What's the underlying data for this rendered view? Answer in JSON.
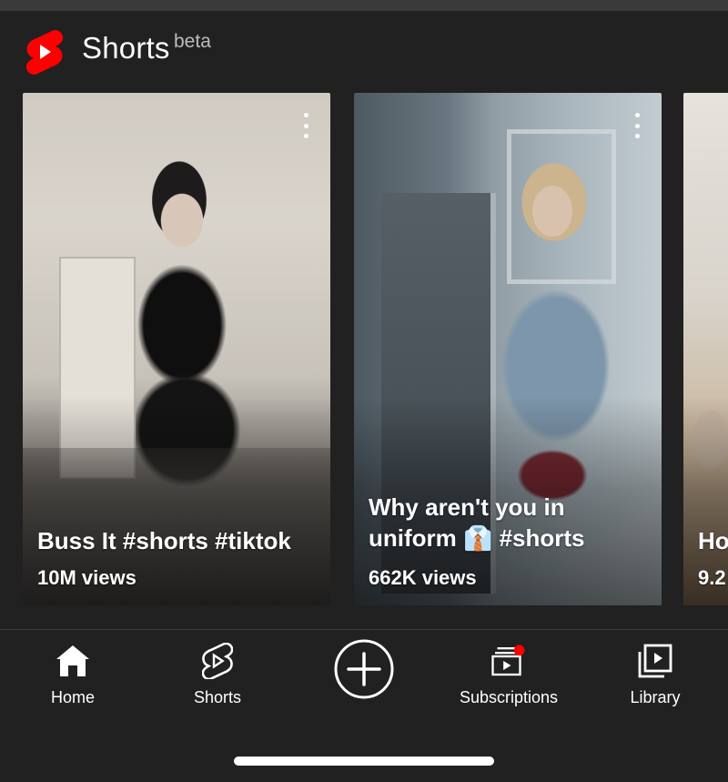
{
  "header": {
    "title": "Shorts",
    "badge": "beta"
  },
  "shelf": {
    "items": [
      {
        "title": "Buss It #shorts #tiktok",
        "views": "10M views"
      },
      {
        "title": "Why aren't you in uniform 👔 #shorts",
        "views": "662K views"
      },
      {
        "title": "Ho",
        "views": "9.2"
      }
    ]
  },
  "nav": {
    "home": "Home",
    "shorts": "Shorts",
    "subscriptions": "Subscriptions",
    "library": "Library"
  },
  "colors": {
    "background": "#212121",
    "brand_red": "#ff0000",
    "notification_dot": "#ff0000"
  },
  "icons": {
    "logo": "shorts-logo-icon",
    "more": "more-vert-icon",
    "home": "home-icon",
    "shorts": "shorts-icon",
    "create": "add-circle-icon",
    "subscriptions": "subscriptions-icon",
    "library": "library-icon"
  }
}
